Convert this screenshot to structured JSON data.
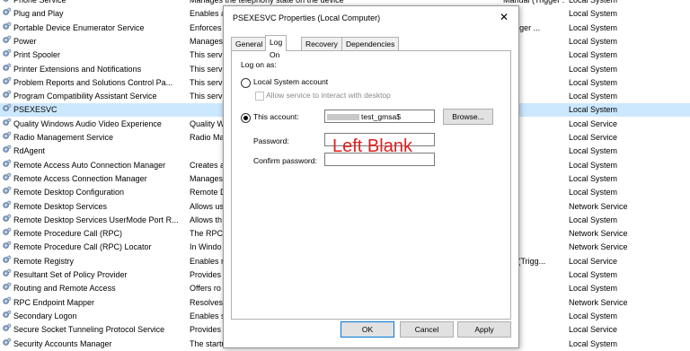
{
  "services": [
    {
      "name": "Phone Service",
      "desc": "Manages the telephony state on the device",
      "startup": "Manual (Trigger ...",
      "logon": "Local System"
    },
    {
      "name": "Plug and Play",
      "desc": "Enables a",
      "startup": "",
      "logon": "Local System"
    },
    {
      "name": "Portable Device Enumerator Service",
      "desc": "Enforces",
      "startup": "(Trigger ...",
      "logon": "Local System"
    },
    {
      "name": "Power",
      "desc": "Manages",
      "startup": "atic",
      "logon": "Local System"
    },
    {
      "name": "Print Spooler",
      "desc": "This servi",
      "startup": "atic",
      "logon": "Local System"
    },
    {
      "name": "Printer Extensions and Notifications",
      "desc": "This servi",
      "startup": "",
      "logon": "Local System"
    },
    {
      "name": "Problem Reports and Solutions Control Pa...",
      "desc": "This servi",
      "startup": "",
      "logon": "Local System"
    },
    {
      "name": "Program Compatibility Assistant Service",
      "desc": "This servi",
      "startup": "atic",
      "logon": "Local System"
    },
    {
      "name": "PSEXESVC",
      "desc": "",
      "startup": "",
      "logon": "Local System"
    },
    {
      "name": "Quality Windows Audio Video Experience",
      "desc": "Quality W",
      "startup": "",
      "logon": "Local Service"
    },
    {
      "name": "Radio Management Service",
      "desc": "Radio Ma",
      "startup": "",
      "logon": "Local Service"
    },
    {
      "name": "RdAgent",
      "desc": "",
      "startup": "atic",
      "logon": "Local System"
    },
    {
      "name": "Remote Access Auto Connection Manager",
      "desc": "Creates a",
      "startup": "",
      "logon": "Local System"
    },
    {
      "name": "Remote Access Connection Manager",
      "desc": "Manages",
      "startup": "",
      "logon": "Local System"
    },
    {
      "name": "Remote Desktop Configuration",
      "desc": "Remote D",
      "startup": "",
      "logon": "Local System"
    },
    {
      "name": "Remote Desktop Services",
      "desc": "Allows us",
      "startup": "",
      "logon": "Network Service"
    },
    {
      "name": "Remote Desktop Services UserMode Port R...",
      "desc": "Allows th",
      "startup": "",
      "logon": "Local System"
    },
    {
      "name": "Remote Procedure Call (RPC)",
      "desc": "The RPCS",
      "startup": "atic",
      "logon": "Network Service"
    },
    {
      "name": "Remote Procedure Call (RPC) Locator",
      "desc": "In Windo",
      "startup": "",
      "logon": "Network Service"
    },
    {
      "name": "Remote Registry",
      "desc": "Enables r",
      "startup": "atic (Trigg...",
      "logon": "Local Service"
    },
    {
      "name": "Resultant Set of Policy Provider",
      "desc": "Provides",
      "startup": "",
      "logon": "Local System"
    },
    {
      "name": "Routing and Remote Access",
      "desc": "Offers ro",
      "startup": "d",
      "logon": "Local System"
    },
    {
      "name": "RPC Endpoint Mapper",
      "desc": "Resolves",
      "startup": "atic",
      "logon": "Network Service"
    },
    {
      "name": "Secondary Logon",
      "desc": "Enables s",
      "startup": "",
      "logon": "Local System"
    },
    {
      "name": "Secure Socket Tunneling Protocol Service",
      "desc": "Provides",
      "startup": "",
      "logon": "Local Service"
    },
    {
      "name": "Security Accounts Manager",
      "desc": "The startu",
      "startup": "atic",
      "logon": "Local System"
    }
  ],
  "dialog": {
    "title": "PSEXESVC Properties (Local Computer)",
    "close_glyph": "✕",
    "tabs": [
      "General",
      "Log On",
      "Recovery",
      "Dependencies"
    ],
    "logon_as_label": "Log on as:",
    "local_system_label": "Local System account",
    "allow_interact_label": "Allow service to interact with desktop",
    "this_account_label": "This account:",
    "account_value": "test_gmsa$",
    "browse_label": "Browse...",
    "password_label": "Password:",
    "confirm_label": "Confirm password:",
    "ok_label": "OK",
    "cancel_label": "Cancel",
    "apply_label": "Apply"
  },
  "annotation": "Left Blank",
  "colors": {
    "selected_row": "#cce8ff",
    "annotation": "#e02020",
    "default_button_border": "#0078d7"
  }
}
